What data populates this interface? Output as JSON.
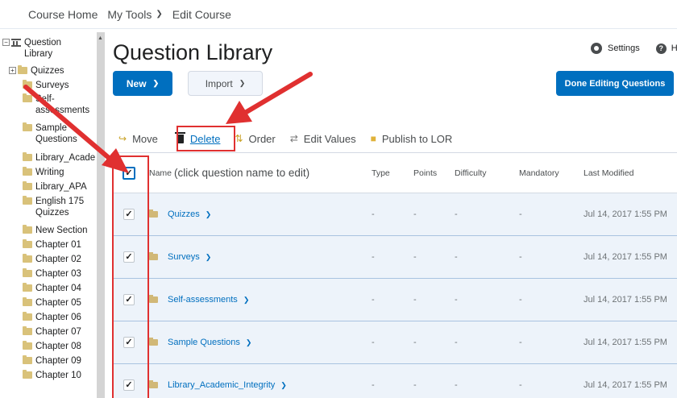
{
  "topnav": {
    "items": [
      "Course Home",
      "My Tools",
      "Edit Course"
    ]
  },
  "tree": {
    "items": [
      {
        "label": "Question\nLibrary",
        "icon": "library-icon"
      },
      {
        "label": "Quizzes"
      },
      {
        "label": "Surveys"
      },
      {
        "label": "Self-\nassessments"
      },
      {
        "label": "Sample\nQuestions"
      },
      {
        "label": "Library_Acade"
      },
      {
        "label": "Writing"
      },
      {
        "label": "Library_APA"
      },
      {
        "label": "English 175\nQuizzes"
      },
      {
        "label": "New Section"
      },
      {
        "label": "Chapter 01"
      },
      {
        "label": "Chapter 02"
      },
      {
        "label": "Chapter 03"
      },
      {
        "label": "Chapter 04"
      },
      {
        "label": "Chapter 05"
      },
      {
        "label": "Chapter 06"
      },
      {
        "label": "Chapter 07"
      },
      {
        "label": "Chapter 08"
      },
      {
        "label": "Chapter 09"
      },
      {
        "label": "Chapter 10"
      }
    ]
  },
  "header": {
    "title": "Question Library",
    "settings_label": "Settings",
    "help_label": "He"
  },
  "buttons": {
    "new_label": "New",
    "import_label": "Import",
    "done_label": "Done Editing Questions"
  },
  "toolbar": {
    "move": "Move",
    "delete": "Delete",
    "order": "Order",
    "edit_values": "Edit Values",
    "publish": "Publish to LOR"
  },
  "table": {
    "columns": {
      "name_prefix": "Name",
      "name_hint": "(click question name to edit)",
      "type": "Type",
      "points": "Points",
      "difficulty": "Difficulty",
      "mandatory": "Mandatory",
      "last_modified": "Last Modified"
    },
    "rows": [
      {
        "name": "Quizzes",
        "type": "-",
        "points": "-",
        "difficulty": "-",
        "mandatory": "-",
        "modified": "Jul 14, 2017 1:55 PM"
      },
      {
        "name": "Surveys",
        "type": "-",
        "points": "-",
        "difficulty": "-",
        "mandatory": "-",
        "modified": "Jul 14, 2017 1:55 PM"
      },
      {
        "name": "Self-assessments",
        "type": "-",
        "points": "-",
        "difficulty": "-",
        "mandatory": "-",
        "modified": "Jul 14, 2017 1:55 PM"
      },
      {
        "name": "Sample Questions",
        "type": "-",
        "points": "-",
        "difficulty": "-",
        "mandatory": "-",
        "modified": "Jul 14, 2017 1:55 PM"
      },
      {
        "name": "Library_Academic_Integrity",
        "type": "-",
        "points": "-",
        "difficulty": "-",
        "mandatory": "-",
        "modified": "Jul 14, 2017 1:55 PM"
      }
    ]
  },
  "colors": {
    "primary": "#006fbf",
    "annotation": "#e03030",
    "row_bg": "#edf3fa"
  }
}
